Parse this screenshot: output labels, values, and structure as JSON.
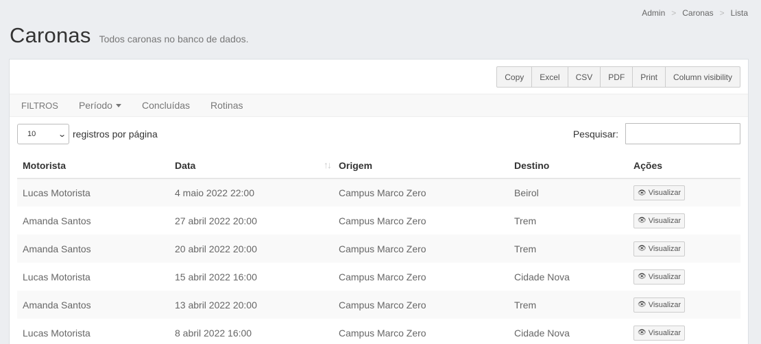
{
  "breadcrumb": [
    "Admin",
    "Caronas",
    "Lista"
  ],
  "header": {
    "title": "Caronas",
    "subtitle": "Todos caronas no banco de dados."
  },
  "export_buttons": [
    "Copy",
    "Excel",
    "CSV",
    "PDF",
    "Print",
    "Column visibility"
  ],
  "filters": {
    "label": "FILTROS",
    "periodo": "Período",
    "concluidas": "Concluídas",
    "rotinas": "Rotinas"
  },
  "length": {
    "value": "10",
    "label": "registros por página"
  },
  "search": {
    "label": "Pesquisar:",
    "value": ""
  },
  "table": {
    "columns": [
      "Motorista",
      "Data",
      "Origem",
      "Destino",
      "Ações"
    ],
    "action_label": "Visualizar",
    "rows": [
      [
        "Lucas Motorista",
        "4 maio 2022 22:00",
        "Campus Marco Zero",
        "Beirol"
      ],
      [
        "Amanda Santos",
        "27 abril 2022 20:00",
        "Campus Marco Zero",
        "Trem"
      ],
      [
        "Amanda Santos",
        "20 abril 2022 20:00",
        "Campus Marco Zero",
        "Trem"
      ],
      [
        "Lucas Motorista",
        "15 abril 2022 16:00",
        "Campus Marco Zero",
        "Cidade Nova"
      ],
      [
        "Amanda Santos",
        "13 abril 2022 20:00",
        "Campus Marco Zero",
        "Trem"
      ],
      [
        "Lucas Motorista",
        "8 abril 2022 16:00",
        "Campus Marco Zero",
        "Cidade Nova"
      ]
    ]
  }
}
